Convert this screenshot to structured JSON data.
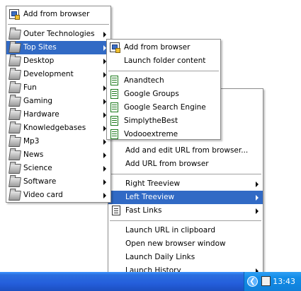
{
  "menu1": {
    "header": "Add from browser",
    "items": [
      {
        "label": "Outer Technologies"
      },
      {
        "label": "Top Sites"
      },
      {
        "label": "Desktop"
      },
      {
        "label": "Development"
      },
      {
        "label": "Fun"
      },
      {
        "label": "Gaming"
      },
      {
        "label": "Hardware"
      },
      {
        "label": "Knowledgebases"
      },
      {
        "label": "Mp3"
      },
      {
        "label": "News"
      },
      {
        "label": "Science"
      },
      {
        "label": "Software"
      },
      {
        "label": "Video card"
      }
    ]
  },
  "menu2": {
    "add_from_browser": "Add from browser",
    "launch_folder": "Launch folder content",
    "links": [
      {
        "label": "Anandtech"
      },
      {
        "label": "Google Groups"
      },
      {
        "label": "Google Search Engine"
      },
      {
        "label": "SimplytheBest"
      },
      {
        "label": "Vodooextreme"
      }
    ]
  },
  "menu3": {
    "add_edit_url": "Add and edit URL from browser...",
    "add_url": "Add URL from browser",
    "right_treeview": "Right Treeview",
    "left_treeview": "Left Treeview",
    "fast_links": "Fast Links",
    "launch_clipboard": "Launch URL in clipboard",
    "open_new_window": "Open new browser window",
    "launch_daily": "Launch Daily Links",
    "launch_history": "Launch History"
  },
  "taskbar": {
    "clock": "13:43",
    "tray_arrow": "❮"
  },
  "colors": {
    "highlight": "#316ac5",
    "taskbar": "#245edb"
  }
}
